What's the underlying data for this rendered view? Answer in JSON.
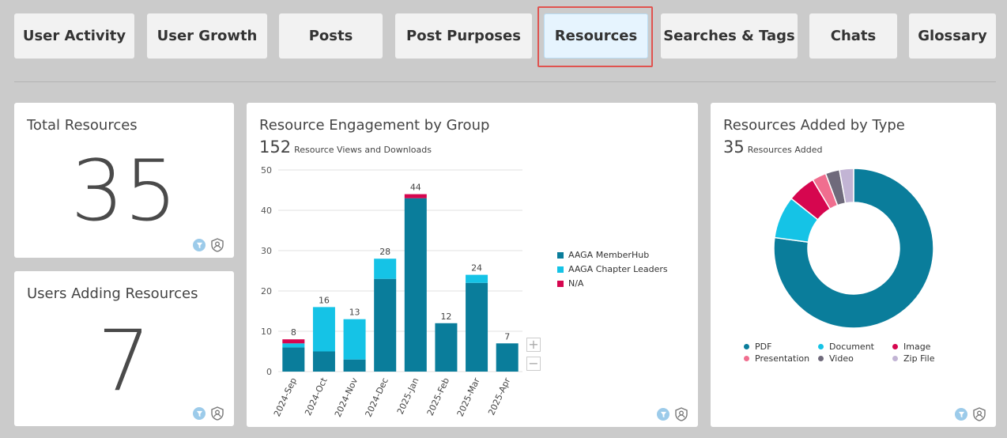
{
  "tabs": [
    {
      "label": "User Activity"
    },
    {
      "label": "User Growth"
    },
    {
      "label": "Posts"
    },
    {
      "label": "Post Purposes"
    },
    {
      "label": "Resources"
    },
    {
      "label": "Searches & Tags"
    },
    {
      "label": "Chats"
    },
    {
      "label": "Glossary"
    }
  ],
  "active_tab": "Resources",
  "total_resources": {
    "title": "Total Resources",
    "value": "35"
  },
  "users_adding": {
    "title": "Users Adding Resources",
    "value": "7"
  },
  "engagement": {
    "title": "Resource Engagement by Group",
    "total": "152",
    "total_label": "Resource Views and Downloads",
    "zoom_in": "+",
    "zoom_out": "−"
  },
  "added_by_type": {
    "title": "Resources Added by Type",
    "total": "35",
    "total_label": "Resources Added"
  },
  "colors": {
    "memberhub": "#0a7d9b",
    "chapter": "#15c3e6",
    "na": "#d6064f",
    "pdf": "#0a7d9b",
    "document": "#15c3e6",
    "image": "#d6064f",
    "presentation": "#f06e8f",
    "video": "#6f6a7b",
    "zip": "#c2b4d4",
    "filter": "#9ccbea"
  },
  "chart_data": [
    {
      "type": "bar",
      "stacked": true,
      "categories": [
        "2024-Sep",
        "2024-Oct",
        "2024-Nov",
        "2024-Dec",
        "2025-Jan",
        "2025-Feb",
        "2025-Mar",
        "2025-Apr"
      ],
      "series": [
        {
          "name": "AAGA MemberHub",
          "values": [
            6,
            5,
            3,
            23,
            43,
            12,
            22,
            7
          ]
        },
        {
          "name": "AAGA Chapter Leaders",
          "values": [
            1,
            11,
            10,
            5,
            0,
            0,
            2,
            0
          ]
        },
        {
          "name": "N/A",
          "values": [
            1,
            0,
            0,
            0,
            1,
            0,
            0,
            0
          ]
        }
      ],
      "totals": [
        8,
        16,
        13,
        28,
        44,
        12,
        24,
        7
      ],
      "ylim": [
        0,
        50
      ],
      "yticks": [
        0,
        10,
        20,
        30,
        40,
        50
      ],
      "grid": true,
      "legend": "right"
    },
    {
      "type": "pie",
      "donut": true,
      "categories": [
        "PDF",
        "Document",
        "Image",
        "Presentation",
        "Video",
        "Zip File"
      ],
      "values": [
        27,
        3,
        2,
        1,
        1,
        1
      ],
      "legend": "bottom"
    }
  ]
}
